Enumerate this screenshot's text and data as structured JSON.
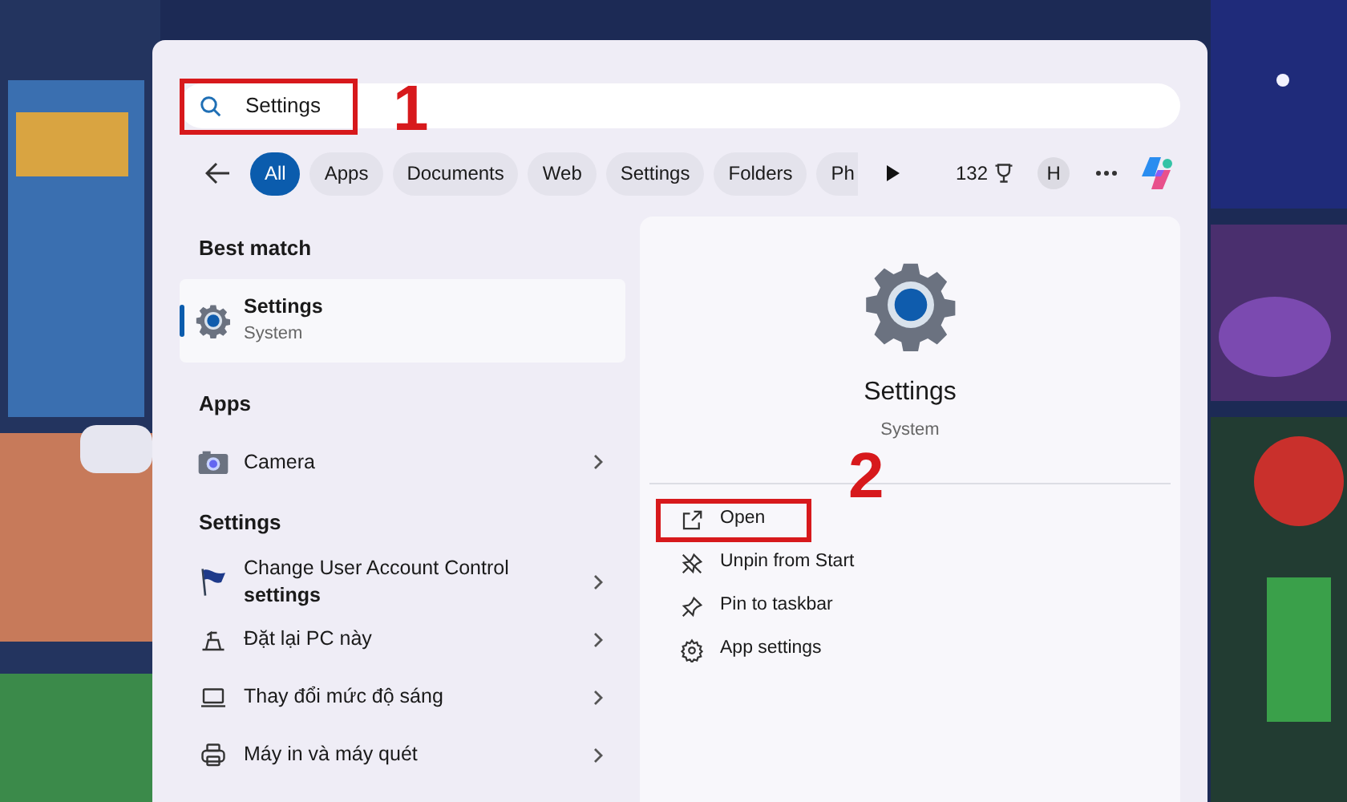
{
  "search": {
    "value": "Settings",
    "highlighted": true,
    "annotation": "1"
  },
  "filters": [
    {
      "label": "All",
      "selected": true
    },
    {
      "label": "Apps",
      "selected": false
    },
    {
      "label": "Documents",
      "selected": false
    },
    {
      "label": "Web",
      "selected": false
    },
    {
      "label": "Settings",
      "selected": false
    },
    {
      "label": "Folders",
      "selected": false
    },
    {
      "label": "Ph",
      "selected": false
    }
  ],
  "points": "132",
  "avatar": "H",
  "sections": [
    {
      "title": "Best match",
      "items": [
        {
          "kind": "gear",
          "title": "Settings",
          "subtitle": "System",
          "selected": true
        }
      ]
    },
    {
      "title": "Apps",
      "items": [
        {
          "kind": "camera",
          "title": "Camera",
          "selected": false
        }
      ]
    },
    {
      "title": "Settings",
      "items": [
        {
          "kind": "flag",
          "title": "Change User Account Control **settings**",
          "selected": false
        },
        {
          "kind": "reset",
          "title": "Đặt lại PC này",
          "selected": false
        },
        {
          "kind": "laptop",
          "title": "Thay đổi mức độ sáng",
          "selected": false
        },
        {
          "kind": "printer",
          "title": "Máy in và máy quét",
          "selected": false
        }
      ]
    }
  ],
  "detail": {
    "title": "Settings",
    "subtitle": "System",
    "actions": [
      {
        "kind": "open",
        "label": "Open",
        "highlighted": true,
        "annotation": "2"
      },
      {
        "kind": "unpin",
        "label": "Unpin from Start",
        "highlighted": false
      },
      {
        "kind": "pin",
        "label": "Pin to taskbar",
        "highlighted": false
      },
      {
        "kind": "gear",
        "label": "App settings",
        "highlighted": false
      }
    ]
  }
}
